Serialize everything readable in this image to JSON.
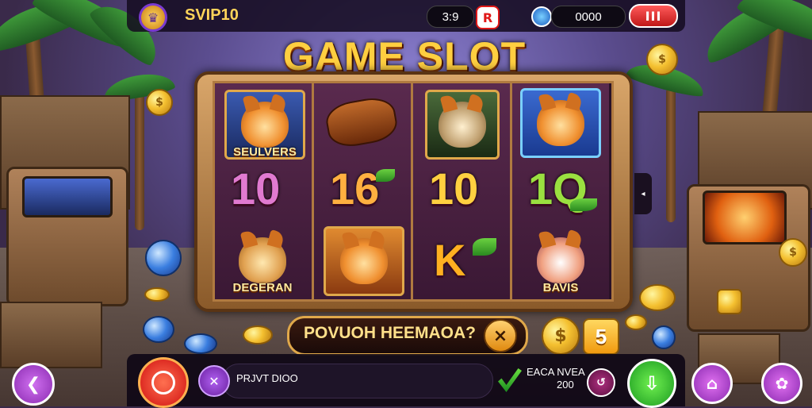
{
  "header": {
    "vip_label": "SVIP10",
    "timer": "3:9",
    "balance": "0000",
    "red_badge": "R",
    "menu_icon": "III"
  },
  "title": "GAME SLOT",
  "reels": {
    "row1": [
      "SEULVERS",
      "",
      "",
      ""
    ],
    "row2": [
      "10",
      "16",
      "10",
      "1Q"
    ],
    "row3": [
      "DEGERAN",
      "",
      "K",
      "BAVIS"
    ]
  },
  "message_bar": {
    "text": "POVUOH HEEMAOA?",
    "close": "×"
  },
  "win_count": "5",
  "bottom": {
    "info_text": "PRJVT DIOO",
    "earn_line1": "EACA NVEA",
    "earn_line2": "200"
  },
  "colors": {
    "accent_gold": "#ffcf40",
    "panel_dark": "#0f0816",
    "purple_btn": "#9a3ad0",
    "green_btn": "#2ac040",
    "red_btn": "#e02020"
  }
}
